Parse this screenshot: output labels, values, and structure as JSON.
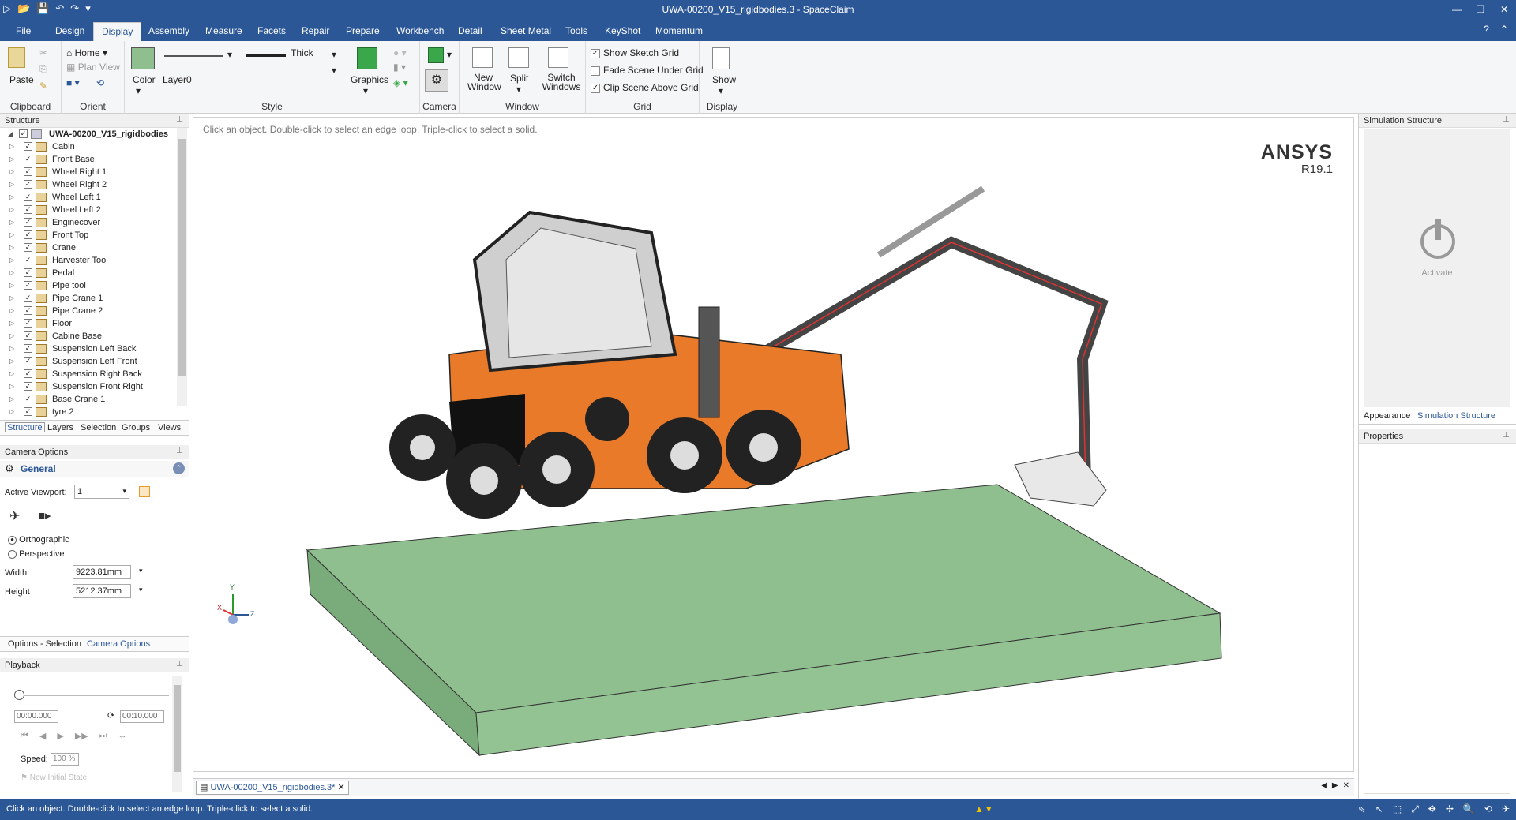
{
  "window": {
    "title": "UWA-00200_V15_rigidbodies.3 - SpaceClaim"
  },
  "menu": {
    "tabs": [
      "File",
      "Design",
      "Display",
      "Assembly",
      "Measure",
      "Facets",
      "Repair",
      "Prepare",
      "Workbench",
      "Detail",
      "Sheet Metal",
      "Tools",
      "KeyShot",
      "Momentum"
    ],
    "active": "Display"
  },
  "ribbon": {
    "clipboard": {
      "paste": "Paste",
      "group": "Clipboard"
    },
    "orient": {
      "home": "Home",
      "plan_view": "Plan View",
      "group": "Orient"
    },
    "style": {
      "color": "Color",
      "layer": "Layer0",
      "thick": "Thick",
      "graphics": "Graphics",
      "group": "Style"
    },
    "camera": {
      "group": "Camera"
    },
    "window": {
      "new_window": "New Window",
      "split": "Split",
      "switch_windows": "Switch Windows",
      "group": "Window"
    },
    "grid": {
      "show_sketch_grid": "Show Sketch Grid",
      "fade_scene": "Fade Scene Under Grid",
      "clip_scene": "Clip Scene Above Grid",
      "group": "Grid"
    },
    "display": {
      "show": "Show",
      "group": "Display"
    }
  },
  "structure": {
    "header": "Structure",
    "root": "UWA-00200_V15_rigidbodies",
    "items": [
      "Cabin",
      "Front Base",
      "Wheel Right 1",
      "Wheel Right 2",
      "Wheel Left 1",
      "Wheel Left 2",
      "Enginecover",
      "Front Top",
      "Crane",
      "Harvester Tool",
      "Pedal",
      "Pipe tool",
      "Pipe Crane 1",
      "Pipe Crane 2",
      "Floor",
      "Cabine Base",
      "Suspension Left Back",
      "Suspension Left Front",
      "Suspension Right Back",
      "Suspension Front Right",
      "Base Crane 1",
      "tyre.2"
    ],
    "tabs": [
      "Structure",
      "Layers",
      "Selection",
      "Groups",
      "Views"
    ]
  },
  "camera_options": {
    "header": "Camera Options",
    "general": "General",
    "active_viewport_label": "Active Viewport:",
    "active_viewport": "1",
    "orthographic": "Orthographic",
    "perspective": "Perspective",
    "width_label": "Width",
    "width": "9223.81mm",
    "height_label": "Height",
    "height": "5212.37mm",
    "tabs": [
      "Options - Selection",
      "Camera Options"
    ]
  },
  "playback": {
    "header": "Playback",
    "start_time": "00:00.000",
    "end_time": "00:10.000",
    "speed_label": "Speed:",
    "speed": "100 %",
    "initial_state": "New Initial State"
  },
  "viewport": {
    "hint": "Click an object. Double-click to select an edge loop. Triple-click to select a solid.",
    "brand": "ANSYS",
    "version": "R19.1",
    "axis_y": "Y",
    "axis_x": "X",
    "axis_z": "Z",
    "doc_tab": "UWA-00200_V15_rigidbodies.3*"
  },
  "right_panel": {
    "simulation_header": "Simulation Structure",
    "activate": "Activate",
    "tabs": [
      "Appearance",
      "Simulation Structure"
    ],
    "properties_header": "Properties"
  },
  "status": {
    "message": "Click an object. Double-click to select an edge loop. Triple-click to select a solid."
  },
  "colors": {
    "accent": "#2b5797",
    "ground": "#8fbf8f",
    "body_orange": "#e87a2a"
  }
}
